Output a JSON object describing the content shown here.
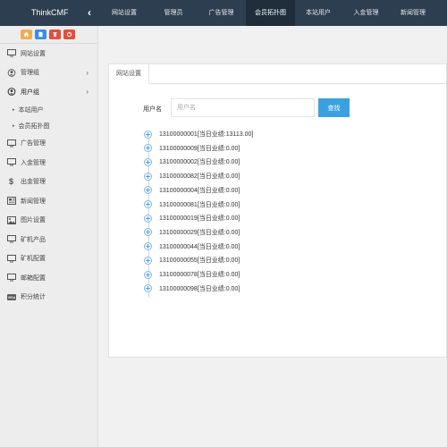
{
  "brand": "ThinkCMF",
  "topnav": [
    {
      "label": "网站设置",
      "active": false
    },
    {
      "label": "管理员",
      "active": false
    },
    {
      "label": "广告管理",
      "active": false
    },
    {
      "label": "会员拓扑图",
      "active": true
    },
    {
      "label": "本站用户",
      "active": false
    },
    {
      "label": "入金管理",
      "active": false
    },
    {
      "label": "新闻管理",
      "active": false
    }
  ],
  "shortcuts": [
    {
      "icon": "home-icon",
      "color": "#f0ad4e"
    },
    {
      "icon": "file-icon",
      "color": "#3a8ee6"
    },
    {
      "icon": "trash-icon",
      "color": "#e74c3c"
    },
    {
      "icon": "refresh-icon",
      "color": "#e74c3c"
    }
  ],
  "sidebar": {
    "items": [
      {
        "label": "网站设置",
        "icon": "monitor-icon"
      },
      {
        "label": "管理组",
        "icon": "user-circle-icon",
        "arrow": "›"
      },
      {
        "label": "用户组",
        "icon": "user-icon",
        "arrow": "›"
      },
      {
        "label": "广告管理",
        "icon": "monitor-icon"
      },
      {
        "label": "入金管理",
        "icon": "monitor-icon"
      },
      {
        "label": "出金管理",
        "icon": "dollar-icon"
      },
      {
        "label": "新闻管理",
        "icon": "newspaper-icon"
      },
      {
        "label": "图片设置",
        "icon": "image-icon"
      },
      {
        "label": "矿机产品",
        "icon": "monitor-icon"
      },
      {
        "label": "矿机配置",
        "icon": "monitor-icon"
      },
      {
        "label": "邮箱配置",
        "icon": "monitor-icon"
      },
      {
        "label": "积分统计",
        "icon": "visa-icon"
      }
    ],
    "subitems": [
      {
        "label": "本站用户"
      },
      {
        "label": "会员拓扑图"
      }
    ]
  },
  "tab": {
    "label": "网站设置"
  },
  "search": {
    "label": "用户名",
    "placeholder": "用户名",
    "button": "查找"
  },
  "tree": [
    "13100000001[当日业绩:13113.00]",
    "13100000009[当日业绩:0.00]",
    "13100000002[当日业绩:0.00]",
    "13100000082[当日业绩:0.00]",
    "13100000004[当日业绩:0.00]",
    "13100000081[当日业绩:0.00]",
    "13100000019[当日业绩:0.00]",
    "13100000029[当日业绩:0.00]",
    "13100000044[当日业绩:0.00]",
    "13100000055[当日业绩:0.00]",
    "13100000078[当日业绩:0.00]",
    "13100000098[当日业绩:0.00]"
  ],
  "colors": {
    "topbar": "#2c3e50",
    "accent": "#3aa1e0"
  }
}
